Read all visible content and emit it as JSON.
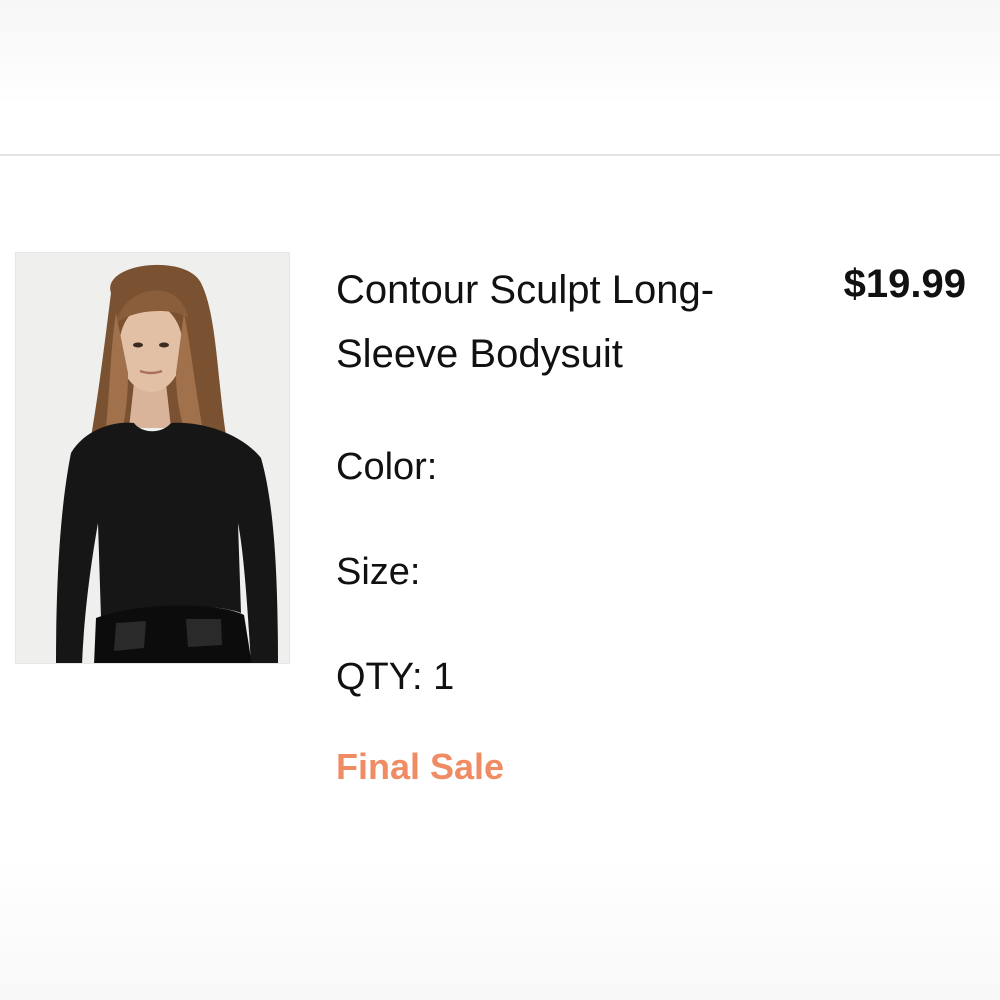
{
  "cart_item": {
    "title": "Contour Sculpt Long-Sleeve Bodysuit",
    "price": "$19.99",
    "color_label": "Color:",
    "size_label": "Size:",
    "qty_label": "QTY: 1",
    "sale_badge": "Final Sale"
  },
  "colors": {
    "sale_accent": "#ef8c63",
    "text": "#111111",
    "divider": "#e3e3e3"
  }
}
